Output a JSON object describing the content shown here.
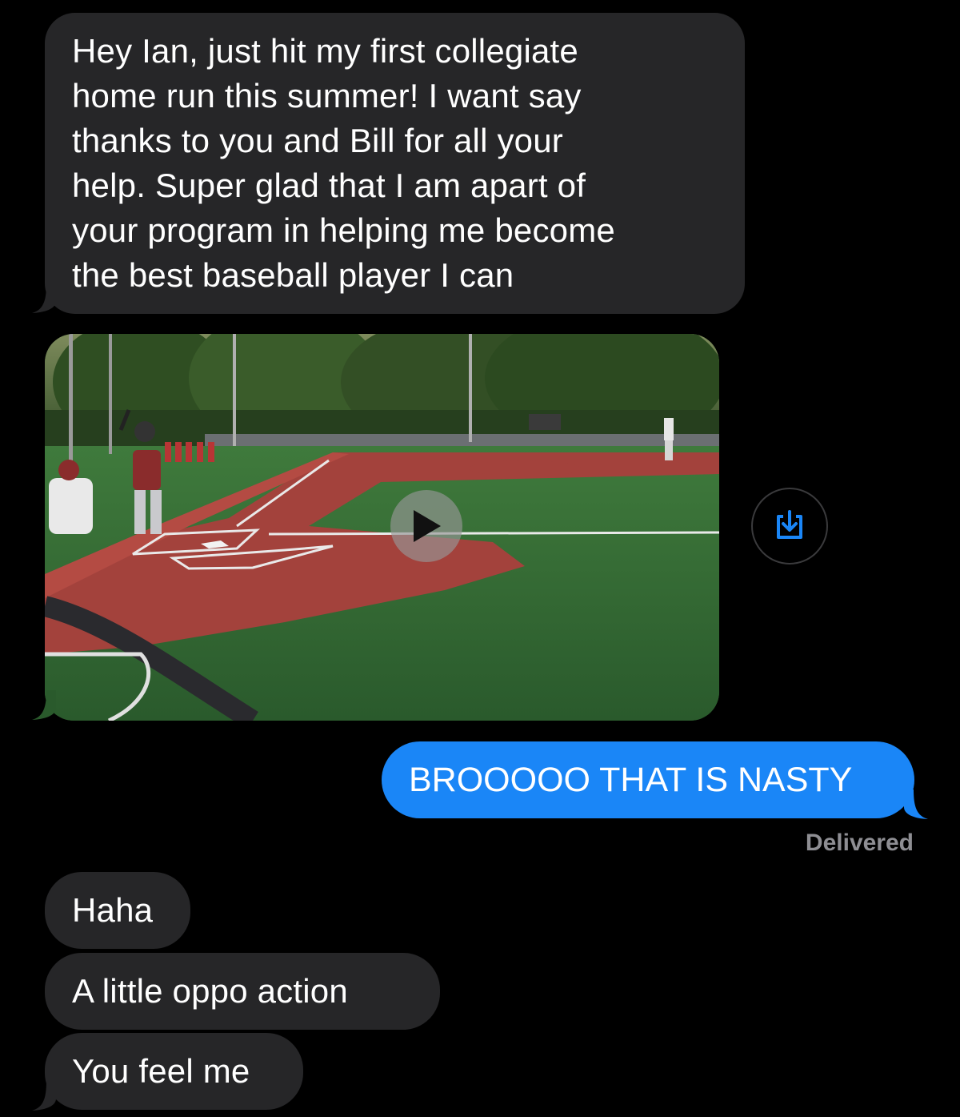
{
  "messages": {
    "m1": {
      "lines": [
        "Hey Ian, just hit my first collegiate",
        "home run this summer! I want say",
        "thanks to you and Bill for all your",
        "help. Super glad that I am apart of",
        "your program in helping me become",
        "the best baseball player I can"
      ]
    },
    "video": {
      "play_icon": "play-icon",
      "save_icon": "download-icon"
    },
    "outgoing": {
      "text": "BROOOOO THAT IS NASTY",
      "status": "Delivered"
    },
    "m3": {
      "text": "Haha"
    },
    "m4": {
      "text": "A little oppo action"
    },
    "m5": {
      "text": "You feel me"
    }
  },
  "colors": {
    "background": "#000000",
    "incoming_bubble": "#262628",
    "outgoing_bubble": "#1a86f7",
    "status_text": "#8e8e93",
    "save_icon": "#1a86f7"
  }
}
